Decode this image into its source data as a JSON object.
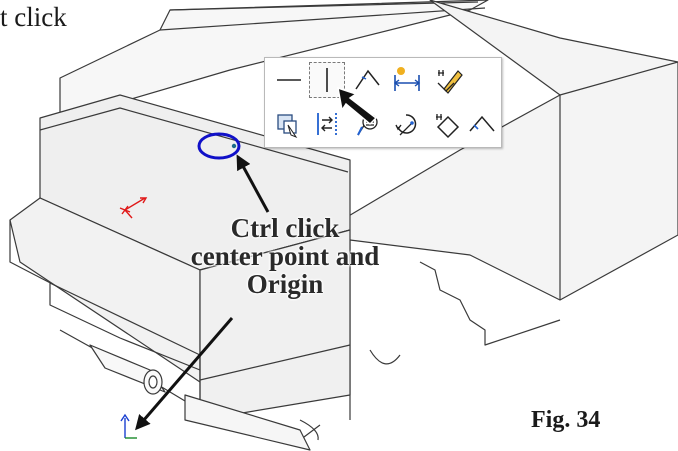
{
  "captions": {
    "top": "t click",
    "callout_lines": [
      "Ctrl click",
      "center point and",
      "Origin"
    ],
    "figure": "Fig. 34"
  },
  "toolbar": {
    "row1": [
      {
        "name": "horizontal-relation-icon"
      },
      {
        "name": "vertical-relation-icon",
        "selected": true
      },
      {
        "name": "smart-dimension-icon"
      },
      {
        "name": "horizontal-dimension-icon"
      },
      {
        "name": "edit-sketch-icon"
      }
    ],
    "row2": [
      {
        "name": "copy-entities-icon"
      },
      {
        "name": "vertical-constraint-icon"
      },
      {
        "name": "display-relations-icon"
      },
      {
        "name": "sketch-rotate-icon"
      },
      {
        "name": "sketch-edit-icon"
      },
      {
        "name": "angle-icon"
      }
    ]
  },
  "colors": {
    "highlight_circle": "#1010c8",
    "origin_red": "#e01818",
    "origin_blue": "#1a3fd0",
    "origin_green": "#1a8a2a",
    "model_edge": "#3a3a3a"
  }
}
